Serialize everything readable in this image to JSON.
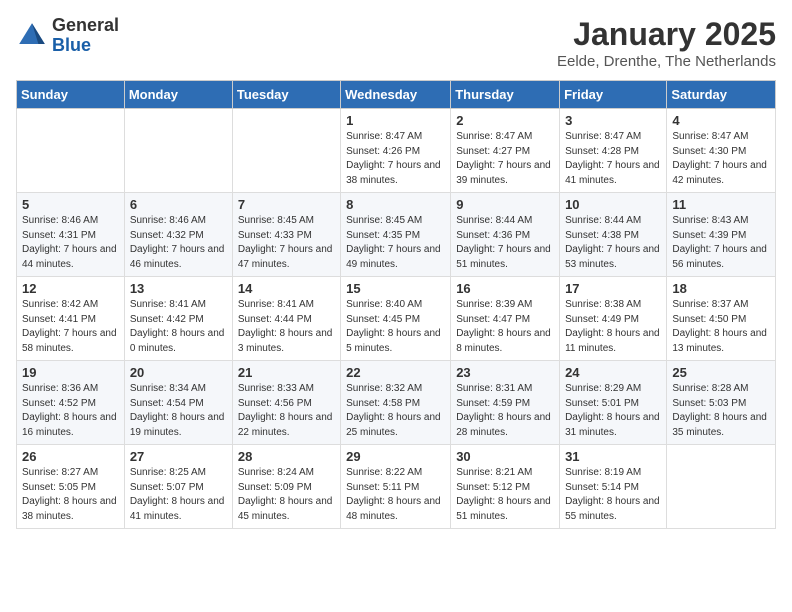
{
  "header": {
    "logo_general": "General",
    "logo_blue": "Blue",
    "month_title": "January 2025",
    "subtitle": "Eelde, Drenthe, The Netherlands"
  },
  "days_of_week": [
    "Sunday",
    "Monday",
    "Tuesday",
    "Wednesday",
    "Thursday",
    "Friday",
    "Saturday"
  ],
  "weeks": [
    [
      {
        "day": "",
        "info": ""
      },
      {
        "day": "",
        "info": ""
      },
      {
        "day": "",
        "info": ""
      },
      {
        "day": "1",
        "info": "Sunrise: 8:47 AM\nSunset: 4:26 PM\nDaylight: 7 hours and 38 minutes."
      },
      {
        "day": "2",
        "info": "Sunrise: 8:47 AM\nSunset: 4:27 PM\nDaylight: 7 hours and 39 minutes."
      },
      {
        "day": "3",
        "info": "Sunrise: 8:47 AM\nSunset: 4:28 PM\nDaylight: 7 hours and 41 minutes."
      },
      {
        "day": "4",
        "info": "Sunrise: 8:47 AM\nSunset: 4:30 PM\nDaylight: 7 hours and 42 minutes."
      }
    ],
    [
      {
        "day": "5",
        "info": "Sunrise: 8:46 AM\nSunset: 4:31 PM\nDaylight: 7 hours and 44 minutes."
      },
      {
        "day": "6",
        "info": "Sunrise: 8:46 AM\nSunset: 4:32 PM\nDaylight: 7 hours and 46 minutes."
      },
      {
        "day": "7",
        "info": "Sunrise: 8:45 AM\nSunset: 4:33 PM\nDaylight: 7 hours and 47 minutes."
      },
      {
        "day": "8",
        "info": "Sunrise: 8:45 AM\nSunset: 4:35 PM\nDaylight: 7 hours and 49 minutes."
      },
      {
        "day": "9",
        "info": "Sunrise: 8:44 AM\nSunset: 4:36 PM\nDaylight: 7 hours and 51 minutes."
      },
      {
        "day": "10",
        "info": "Sunrise: 8:44 AM\nSunset: 4:38 PM\nDaylight: 7 hours and 53 minutes."
      },
      {
        "day": "11",
        "info": "Sunrise: 8:43 AM\nSunset: 4:39 PM\nDaylight: 7 hours and 56 minutes."
      }
    ],
    [
      {
        "day": "12",
        "info": "Sunrise: 8:42 AM\nSunset: 4:41 PM\nDaylight: 7 hours and 58 minutes."
      },
      {
        "day": "13",
        "info": "Sunrise: 8:41 AM\nSunset: 4:42 PM\nDaylight: 8 hours and 0 minutes."
      },
      {
        "day": "14",
        "info": "Sunrise: 8:41 AM\nSunset: 4:44 PM\nDaylight: 8 hours and 3 minutes."
      },
      {
        "day": "15",
        "info": "Sunrise: 8:40 AM\nSunset: 4:45 PM\nDaylight: 8 hours and 5 minutes."
      },
      {
        "day": "16",
        "info": "Sunrise: 8:39 AM\nSunset: 4:47 PM\nDaylight: 8 hours and 8 minutes."
      },
      {
        "day": "17",
        "info": "Sunrise: 8:38 AM\nSunset: 4:49 PM\nDaylight: 8 hours and 11 minutes."
      },
      {
        "day": "18",
        "info": "Sunrise: 8:37 AM\nSunset: 4:50 PM\nDaylight: 8 hours and 13 minutes."
      }
    ],
    [
      {
        "day": "19",
        "info": "Sunrise: 8:36 AM\nSunset: 4:52 PM\nDaylight: 8 hours and 16 minutes."
      },
      {
        "day": "20",
        "info": "Sunrise: 8:34 AM\nSunset: 4:54 PM\nDaylight: 8 hours and 19 minutes."
      },
      {
        "day": "21",
        "info": "Sunrise: 8:33 AM\nSunset: 4:56 PM\nDaylight: 8 hours and 22 minutes."
      },
      {
        "day": "22",
        "info": "Sunrise: 8:32 AM\nSunset: 4:58 PM\nDaylight: 8 hours and 25 minutes."
      },
      {
        "day": "23",
        "info": "Sunrise: 8:31 AM\nSunset: 4:59 PM\nDaylight: 8 hours and 28 minutes."
      },
      {
        "day": "24",
        "info": "Sunrise: 8:29 AM\nSunset: 5:01 PM\nDaylight: 8 hours and 31 minutes."
      },
      {
        "day": "25",
        "info": "Sunrise: 8:28 AM\nSunset: 5:03 PM\nDaylight: 8 hours and 35 minutes."
      }
    ],
    [
      {
        "day": "26",
        "info": "Sunrise: 8:27 AM\nSunset: 5:05 PM\nDaylight: 8 hours and 38 minutes."
      },
      {
        "day": "27",
        "info": "Sunrise: 8:25 AM\nSunset: 5:07 PM\nDaylight: 8 hours and 41 minutes."
      },
      {
        "day": "28",
        "info": "Sunrise: 8:24 AM\nSunset: 5:09 PM\nDaylight: 8 hours and 45 minutes."
      },
      {
        "day": "29",
        "info": "Sunrise: 8:22 AM\nSunset: 5:11 PM\nDaylight: 8 hours and 48 minutes."
      },
      {
        "day": "30",
        "info": "Sunrise: 8:21 AM\nSunset: 5:12 PM\nDaylight: 8 hours and 51 minutes."
      },
      {
        "day": "31",
        "info": "Sunrise: 8:19 AM\nSunset: 5:14 PM\nDaylight: 8 hours and 55 minutes."
      },
      {
        "day": "",
        "info": ""
      }
    ]
  ]
}
